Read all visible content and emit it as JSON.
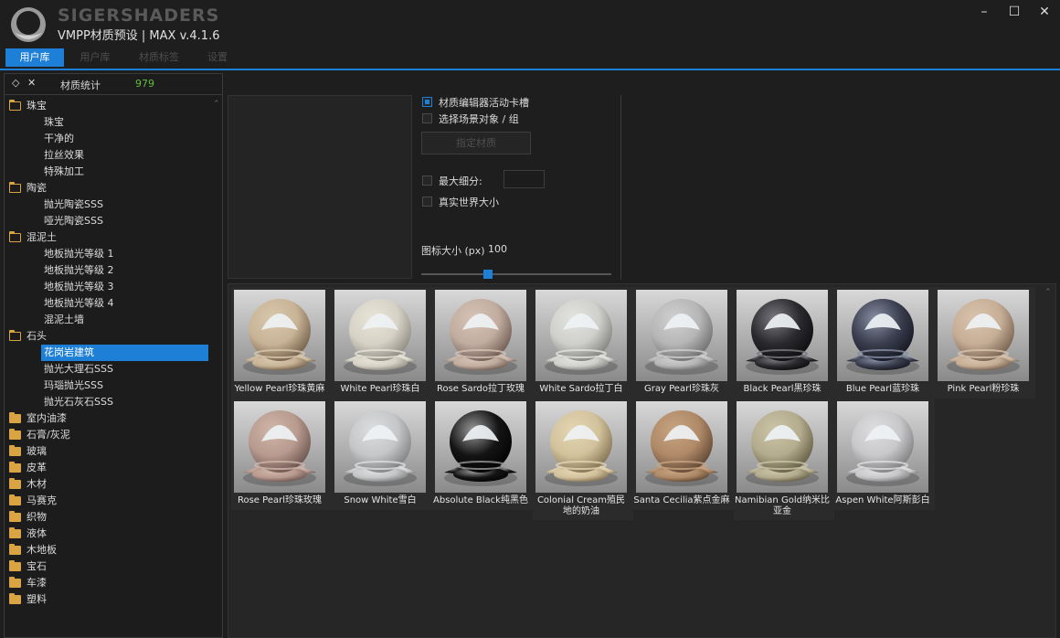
{
  "app": {
    "brand": "SIGERSHADERS",
    "subtitle": "VMPP材质预设 | MAX v.4.1.6",
    "window_controls": [
      "minimize-icon",
      "maximize-icon",
      "close-icon"
    ]
  },
  "tabs": [
    {
      "label": "用户库",
      "active": true
    },
    {
      "label": "用户库",
      "active": false
    },
    {
      "label": "材质标签",
      "active": false
    },
    {
      "label": "设置",
      "active": false
    }
  ],
  "left": {
    "header_icons": [
      "diamond-icon",
      "x-icon"
    ],
    "stats_label": "材质统计",
    "stats_count": "979",
    "tree": [
      {
        "label": "珠宝",
        "type": "folder",
        "open": true
      },
      {
        "label": "珠宝",
        "type": "item"
      },
      {
        "label": "干净的",
        "type": "item"
      },
      {
        "label": "拉丝效果",
        "type": "item"
      },
      {
        "label": "特殊加工",
        "type": "item"
      },
      {
        "label": "陶瓷",
        "type": "folder",
        "open": true
      },
      {
        "label": "抛光陶瓷SSS",
        "type": "item"
      },
      {
        "label": "哑光陶瓷SSS",
        "type": "item"
      },
      {
        "label": "混泥土",
        "type": "folder",
        "open": true
      },
      {
        "label": "地板抛光等级 1",
        "type": "item"
      },
      {
        "label": "地板抛光等级 2",
        "type": "item"
      },
      {
        "label": "地板抛光等级 3",
        "type": "item"
      },
      {
        "label": "地板抛光等级 4",
        "type": "item"
      },
      {
        "label": "混泥土墙",
        "type": "item"
      },
      {
        "label": "石头",
        "type": "folder",
        "open": true
      },
      {
        "label": "花岗岩建筑",
        "type": "item",
        "selected": true
      },
      {
        "label": "抛光大理石SSS",
        "type": "item"
      },
      {
        "label": "玛瑙抛光SSS",
        "type": "item"
      },
      {
        "label": "抛光石灰石SSS",
        "type": "item"
      },
      {
        "label": "室内油漆",
        "type": "folder",
        "open": false
      },
      {
        "label": "石膏/灰泥",
        "type": "folder",
        "open": false
      },
      {
        "label": "玻璃",
        "type": "folder",
        "open": false
      },
      {
        "label": "皮革",
        "type": "folder",
        "open": false
      },
      {
        "label": "木材",
        "type": "folder",
        "open": false
      },
      {
        "label": "马赛克",
        "type": "folder",
        "open": false
      },
      {
        "label": "织物",
        "type": "folder",
        "open": false
      },
      {
        "label": "液体",
        "type": "folder",
        "open": false
      },
      {
        "label": "木地板",
        "type": "folder",
        "open": false
      },
      {
        "label": "宝石",
        "type": "folder",
        "open": false
      },
      {
        "label": "车漆",
        "type": "folder",
        "open": false
      },
      {
        "label": "塑料",
        "type": "folder",
        "open": false
      }
    ]
  },
  "options": {
    "active_slot_label": "材质编辑器活动卡槽",
    "active_slot_checked": true,
    "select_objects_label": "选择场景对象 / 组",
    "select_objects_checked": false,
    "assign_button": "指定材质",
    "max_subdiv_label": "最大细分:",
    "max_subdiv_checked": false,
    "max_subdiv_value": "",
    "real_world_label": "真实世界大小",
    "real_world_checked": false,
    "icon_size_label": "图标大小 (px)",
    "icon_size_value": "100",
    "icon_size_slider_fraction": 0.35
  },
  "materials": [
    {
      "name": "Yellow Pearl珍珠黄麻",
      "base": "#c8b396",
      "dark": "#6e5a44",
      "rim": "#d9c8ad"
    },
    {
      "name": "White Pearl珍珠白",
      "base": "#d6d2c6",
      "dark": "#8a867c",
      "rim": "#e8e4d8"
    },
    {
      "name": "Rose Sardo拉丁玫瑰",
      "base": "#c2aca0",
      "dark": "#6a574d",
      "rim": "#d6c2b6"
    },
    {
      "name": "White Sardo拉丁白",
      "base": "#cfcfcc",
      "dark": "#7c7c79",
      "rim": "#e3e3e0"
    },
    {
      "name": "Gray Pearl珍珠灰",
      "base": "#b6b6b6",
      "dark": "#6a6a6a",
      "rim": "#d0d0d0"
    },
    {
      "name": "Black Pearl黑珍珠",
      "base": "#2a2a2e",
      "dark": "#0c0c0e",
      "rim": "#7a7a80"
    },
    {
      "name": "Blue Pearl蓝珍珠",
      "base": "#3a3e4e",
      "dark": "#141620",
      "rim": "#8890a4"
    },
    {
      "name": "Pink Pearl粉珍珠",
      "base": "#c6ad96",
      "dark": "#705c4a",
      "rim": "#dac4ae"
    },
    {
      "name": "Rose Pearl珍珠玫瑰",
      "base": "#b89a8e",
      "dark": "#66504a",
      "rim": "#d0b6aa"
    },
    {
      "name": "Snow White雪白",
      "base": "#c4c6c8",
      "dark": "#7a7c7e",
      "rim": "#dcdee0"
    },
    {
      "name": "Absolute Black纯黑色",
      "base": "#141414",
      "dark": "#020202",
      "rim": "#9a9a9a"
    },
    {
      "name": "Colonial Cream殖民地的奶油",
      "base": "#d2c29c",
      "dark": "#7c6c4c",
      "rim": "#e4d6b4"
    },
    {
      "name": "Santa Cecilia紫点金麻",
      "base": "#b08a68",
      "dark": "#5a4230",
      "rim": "#c8a482"
    },
    {
      "name": "Namibian Gold纳米比亚金",
      "base": "#b4ac8e",
      "dark": "#5e5840",
      "rim": "#ccc4a8"
    },
    {
      "name": "Aspen White阿斯彭白",
      "base": "#c8c8ca",
      "dark": "#7a7a7c",
      "rim": "#dedee0"
    }
  ]
}
